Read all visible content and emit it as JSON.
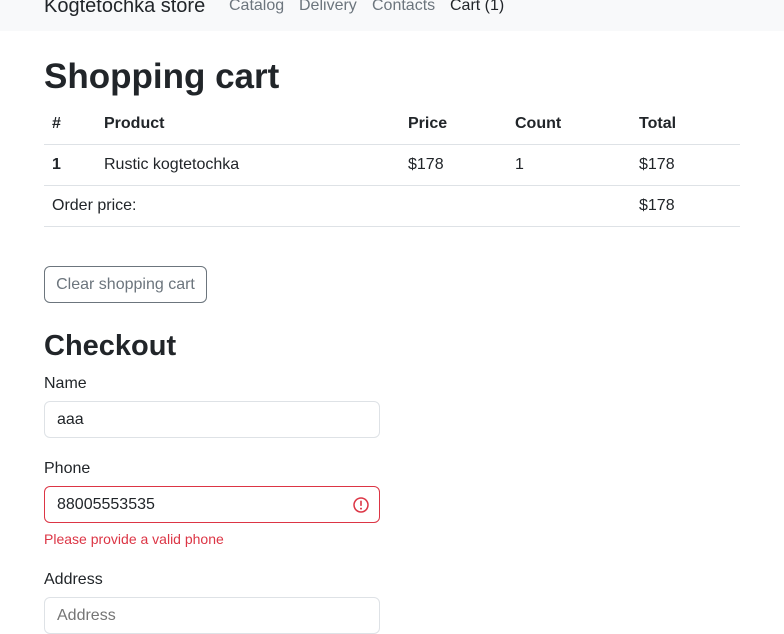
{
  "navbar": {
    "brand": "Kogtetochka store",
    "links": [
      {
        "label": "Catalog"
      },
      {
        "label": "Delivery"
      },
      {
        "label": "Contacts"
      },
      {
        "label": "Cart (1)"
      }
    ]
  },
  "cart": {
    "title": "Shopping cart",
    "columns": [
      "#",
      "Product",
      "Price",
      "Count",
      "Total"
    ],
    "rows": [
      {
        "num": "1",
        "product": "Rustic kogtetochka",
        "price": "$178",
        "count": "1",
        "total": "$178"
      }
    ],
    "order_price_label": "Order price:",
    "order_price_value": "$178",
    "clear_button": "Clear shopping cart"
  },
  "checkout": {
    "title": "Checkout",
    "name_label": "Name",
    "name_value": "aaa",
    "phone_label": "Phone",
    "phone_value": "88005553535",
    "phone_error": "Please provide a valid phone",
    "address_label": "Address",
    "address_placeholder": "Address"
  },
  "colors": {
    "navbar_bg": "#f8f9fa",
    "danger": "#dc3545",
    "secondary": "#6c757d"
  }
}
